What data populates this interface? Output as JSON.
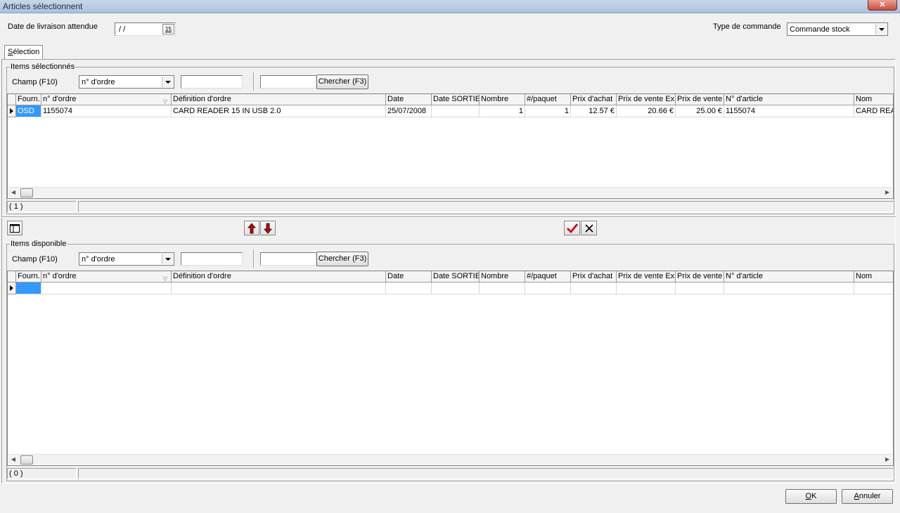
{
  "window": {
    "title": "Articles sélectionnent",
    "close_glyph": "✕"
  },
  "header": {
    "delivery_label": "Date de livraison attendue",
    "delivery_value": " / /",
    "calendar_glyph": "15",
    "order_type_label": "Type de commande",
    "order_type_value": "Commande stock"
  },
  "tabs": [
    {
      "label": "Sélection",
      "mnemonic": "S",
      "rest": "élection"
    }
  ],
  "selected": {
    "group_title": "Items sélectionnés",
    "field_label": "Champ (F10)",
    "field_value": "n° d'ordre",
    "search_button": "Chercher (F3)",
    "columns": [
      "Fourn.",
      "n° d'ordre",
      "Définition d'ordre",
      "Date",
      "Date SORTIE",
      "Nombre",
      "#/paquet",
      "Prix d'achat",
      "Prix de vente Ex",
      "Prix de vente",
      "N° d'article",
      "Nom"
    ],
    "rows": [
      [
        "OSD",
        "1155074",
        "CARD READER 15 IN USB 2.0",
        "25/07/2008",
        "",
        "1",
        "1",
        "12.57 €",
        "20.66 €",
        "25.00 €",
        "1155074",
        "CARD REA"
      ]
    ],
    "status_count": "( 1 )"
  },
  "available": {
    "group_title": "Items disponible",
    "field_label": "Champ (F10)",
    "field_value": "n° d'ordre",
    "search_button": "Chercher (F3)",
    "columns": [
      "Fourn.",
      "n° d'ordre",
      "Définition d'ordre",
      "Date",
      "Date SORTIE",
      "Nombre",
      "#/paquet",
      "Prix d'achat",
      "Prix de vente Ex",
      "Prix de vente",
      "N° d'article",
      "Nom"
    ],
    "status_count": "( 0 )"
  },
  "toolbar": {
    "columns_icon": "columns-icon",
    "move_up_icon": "arrow-up-icon",
    "move_down_icon": "arrow-down-icon",
    "accept_icon": "checkmark-icon",
    "reject_icon": "cross-icon"
  },
  "footer": {
    "ok_label": "OK",
    "ok_mnemonic": "O",
    "ok_rest": "K",
    "cancel_label": "Annuler",
    "cancel_mnemonic": "A",
    "cancel_rest": "nnuler"
  },
  "colors": {
    "selection": "#3399ff",
    "up_arrow": "#cc0000",
    "check": "#cc0000"
  }
}
